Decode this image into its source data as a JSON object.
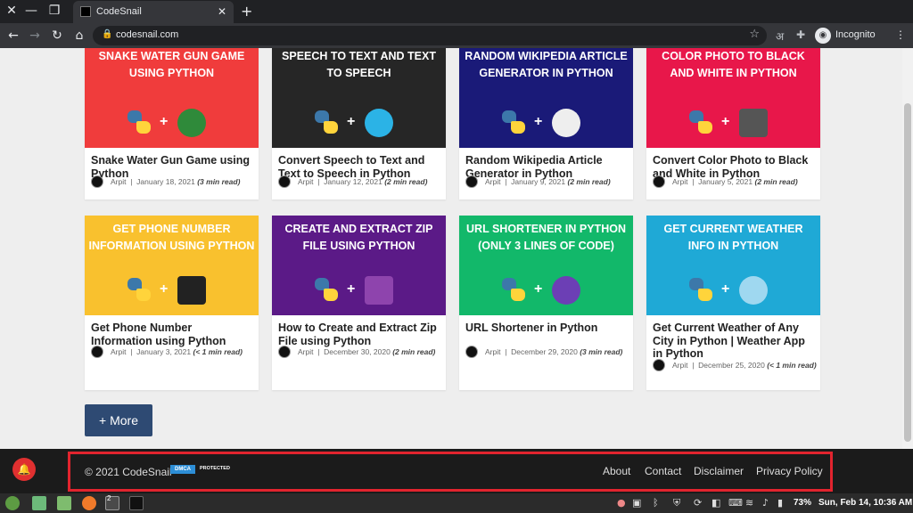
{
  "browser": {
    "tab_title": "CodeSnail",
    "url": "codesnail.com",
    "profile_label": "Incognito",
    "icons": [
      "close-icon",
      "minimize-icon",
      "restore-icon",
      "new-tab-icon",
      "back-icon",
      "forward-icon",
      "reload-icon",
      "lock-icon",
      "star-icon",
      "translate-icon",
      "extensions-icon",
      "incognito-icon",
      "menu-icon"
    ]
  },
  "posts": [
    {
      "thumb_text": "Snake Water Gun Game using Python",
      "thumb_color": "#f03c3c",
      "icon": "snake-gun-icon",
      "title": "Snake Water Gun Game using Python",
      "author": "Arpit",
      "date": "January 18, 2021",
      "read": "(3 min read)"
    },
    {
      "thumb_text": "Speech to Text and Text to Speech",
      "thumb_color": "#262626",
      "icon": "speech-icon",
      "title": "Convert Speech to Text and Text to Speech in Python",
      "author": "Arpit",
      "date": "January 12, 2021",
      "read": "(2 min read)"
    },
    {
      "thumb_text": "Random Wikipedia Article Generator in Python",
      "thumb_color": "#1a1a78",
      "icon": "wikipedia-icon",
      "title": "Random Wikipedia Article Generator in Python",
      "author": "Arpit",
      "date": "January 9, 2021",
      "read": "(2 min read)"
    },
    {
      "thumb_text": "Color Photo to Black and White in Python",
      "thumb_color": "#e8174a",
      "icon": "photo-icon",
      "title": "Convert Color Photo to Black and White in Python",
      "author": "Arpit",
      "date": "January 5, 2021",
      "read": "(2 min read)"
    },
    {
      "thumb_text": "Get Phone Number Information using Python",
      "thumb_color": "#f9c12e",
      "icon": "sim-card-icon",
      "title": "Get Phone Number Information using Python",
      "author": "Arpit",
      "date": "January 3, 2021",
      "read": "(< 1 min read)"
    },
    {
      "thumb_text": "Create and Extract Zip File using Python",
      "thumb_color": "#5b1a87",
      "icon": "zip-archive-icon",
      "title": "How to Create and Extract Zip File using Python",
      "author": "Arpit",
      "date": "December 30, 2020",
      "read": "(2 min read)"
    },
    {
      "thumb_text": "URL Shortener in Python (Only 3 Lines of Code)",
      "thumb_color": "#12b86a",
      "icon": "link-icon",
      "title": "URL Shortener in Python",
      "author": "Arpit",
      "date": "December 29, 2020",
      "read": "(3 min read)"
    },
    {
      "thumb_text": "Get Current Weather Info in Python",
      "thumb_color": "#1fa9d6",
      "icon": "weather-icon",
      "title": "Get Current Weather of Any City in Python | Weather App in Python",
      "author": "Arpit",
      "date": "December 25, 2020",
      "read": "(< 1 min read)"
    }
  ],
  "more_button": "+ More",
  "footer": {
    "copyright": "© 2021 CodeSnail",
    "dmca_badge": "DMCA",
    "dmca_status": "PROTECTED",
    "links": [
      "About",
      "Contact",
      "Disclaimer",
      "Privacy Policy"
    ]
  },
  "taskbar": {
    "window_count": "2",
    "battery": "73%",
    "clock": "Sun, Feb 14, 10:36 AM"
  }
}
